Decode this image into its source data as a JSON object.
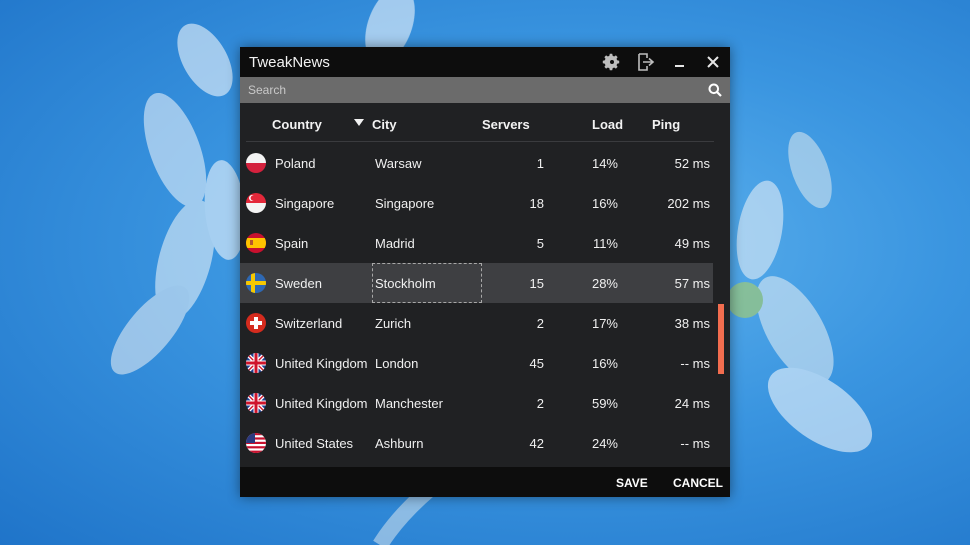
{
  "window": {
    "title": "TweakNews",
    "icons": [
      "gear-icon",
      "logout-icon",
      "minimize-icon",
      "close-icon"
    ]
  },
  "search": {
    "placeholder": "Search",
    "value": "",
    "icon": "search-icon"
  },
  "table": {
    "columns": {
      "country": "Country",
      "city": "City",
      "servers": "Servers",
      "load": "Load",
      "ping": "Ping"
    },
    "sort": {
      "column": "city",
      "direction": "descending-arrow"
    },
    "rows": [
      {
        "flag": "poland",
        "country": "Poland",
        "city": "Warsaw",
        "servers": "1",
        "load": "14%",
        "ping": "52 ms"
      },
      {
        "flag": "singapore",
        "country": "Singapore",
        "city": "Singapore",
        "servers": "18",
        "load": "16%",
        "ping": "202 ms"
      },
      {
        "flag": "spain",
        "country": "Spain",
        "city": "Madrid",
        "servers": "5",
        "load": "11%",
        "ping": "49 ms"
      },
      {
        "flag": "sweden",
        "country": "Sweden",
        "city": "Stockholm",
        "servers": "15",
        "load": "28%",
        "ping": "57 ms",
        "selected": true
      },
      {
        "flag": "switzerland",
        "country": "Switzerland",
        "city": "Zurich",
        "servers": "2",
        "load": "17%",
        "ping": "38 ms"
      },
      {
        "flag": "united-kingdom",
        "country": "United Kingdom",
        "city": "London",
        "servers": "45",
        "load": "16%",
        "ping": "-- ms"
      },
      {
        "flag": "united-kingdom",
        "country": "United Kingdom",
        "city": "Manchester",
        "servers": "2",
        "load": "59%",
        "ping": "24 ms"
      },
      {
        "flag": "united-states",
        "country": "United States",
        "city": "Ashburn",
        "servers": "42",
        "load": "24%",
        "ping": "-- ms"
      }
    ]
  },
  "footer": {
    "save_label": "SAVE",
    "cancel_label": "CANCEL"
  },
  "colors": {
    "window_bg": "#202123",
    "titlebar_bg": "#0d0d0d",
    "searchbar_bg": "#6b6b6b",
    "selected_row_bg": "#3e3f42",
    "scroll_accent": "#f26d4f",
    "desktop_bg": "#3a95e0"
  }
}
